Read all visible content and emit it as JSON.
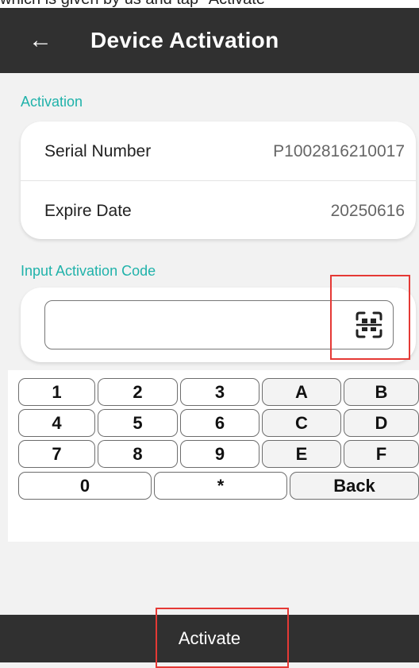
{
  "caption": "which is given by us and tap \"Activate\"",
  "appbar": {
    "back_icon": "arrow-left-icon",
    "title": "Device Activation"
  },
  "activation": {
    "section_label": "Activation",
    "serial_label": "Serial Number",
    "serial_value": "P1002816210017",
    "expire_label": "Expire Date",
    "expire_value": "20250616"
  },
  "code": {
    "section_label": "Input Activation Code",
    "value": "",
    "scan_icon": "scan-qr-icon"
  },
  "keypad": {
    "rows": [
      [
        "1",
        "2",
        "3",
        "A",
        "B"
      ],
      [
        "4",
        "5",
        "6",
        "C",
        "D"
      ],
      [
        "7",
        "8",
        "9",
        "E",
        "F"
      ],
      [
        "0",
        "*",
        "Back"
      ]
    ]
  },
  "actions": {
    "activate_label": "Activate"
  },
  "colors": {
    "appbar": "#303030",
    "accent": "#20b2aa",
    "highlight": "#e53935"
  }
}
